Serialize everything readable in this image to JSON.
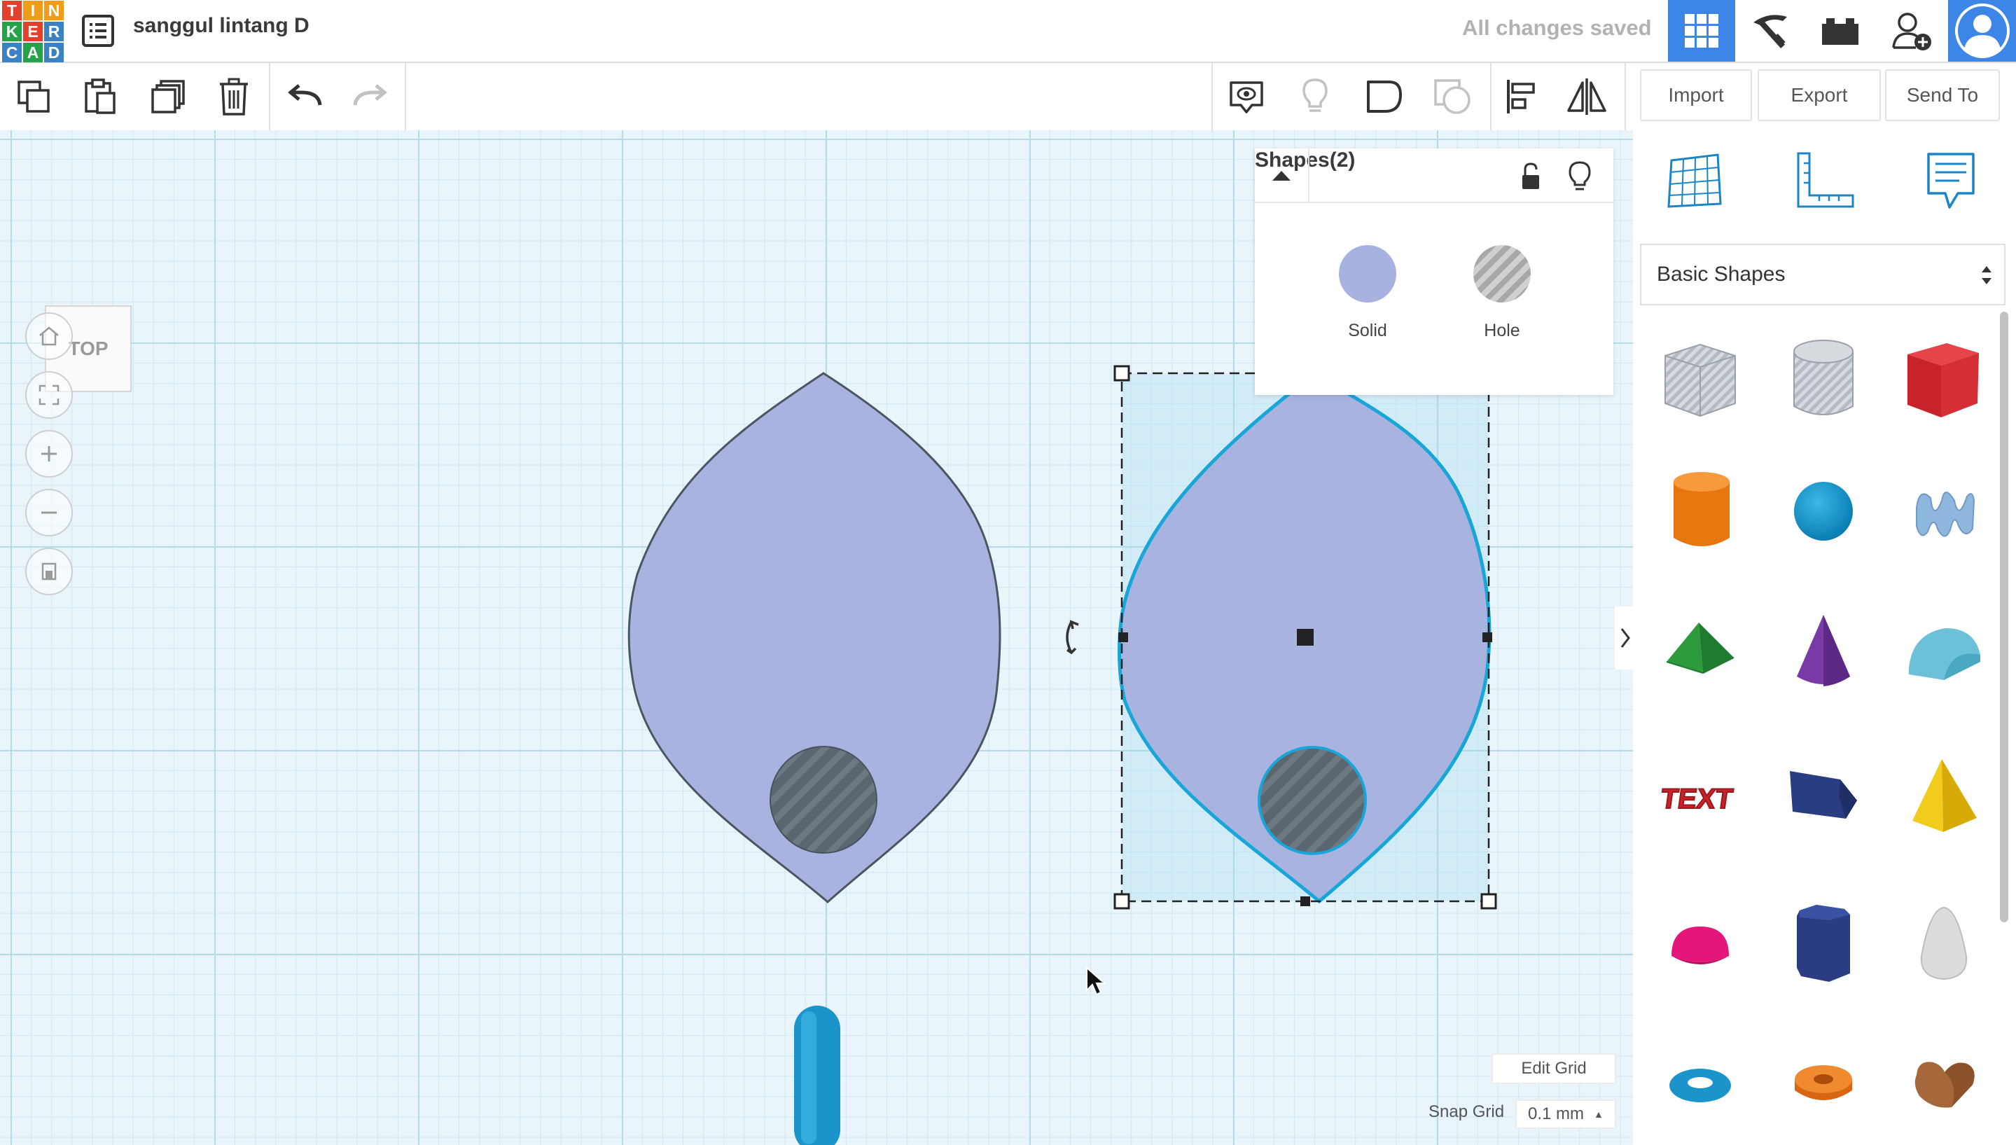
{
  "app": {
    "logo_letters": [
      "T",
      "I",
      "N",
      "K",
      "E",
      "R",
      "C",
      "A",
      "D"
    ],
    "logo_colors": [
      "#e4412c",
      "#f19b1a",
      "#f19b1a",
      "#24a348",
      "#e4412c",
      "#3b82c4",
      "#3b82c4",
      "#24a348",
      "#3b82c4"
    ],
    "design_name": "sanggul lintang D",
    "save_status": "All changes saved"
  },
  "colors": {
    "accent": "#3d85e6",
    "shape_fill": "#a7b2e0",
    "selection": "#1aa3d6",
    "hole": "#5a666f"
  },
  "topbar_icons": [
    "grid-view-icon",
    "pickaxe-icon",
    "bricks-icon",
    "add-user-icon",
    "profile-avatar-icon"
  ],
  "toolbar": {
    "left_tools": [
      "copy-icon",
      "paste-icon",
      "duplicate-icon",
      "delete-icon",
      "undo-icon",
      "redo-icon"
    ],
    "right_tools": [
      "notes-icon",
      "light-icon",
      "group-icon",
      "ungroup-icon",
      "align-icon",
      "mirror-icon"
    ],
    "import_label": "Import",
    "export_label": "Export",
    "send_to_label": "Send To"
  },
  "viewcube": {
    "label": "TOP"
  },
  "nav_controls": [
    "home-view-icon",
    "fit-view-icon",
    "zoom-in-icon",
    "zoom-out-icon",
    "perspective-icon"
  ],
  "inspector": {
    "title": "Shapes(2)",
    "solid_label": "Solid",
    "hole_label": "Hole",
    "solid_color": "#a7b2e0"
  },
  "right_panel": {
    "tabs": [
      "workplane-icon",
      "ruler-icon",
      "notes-tab-icon"
    ],
    "category": "Basic Shapes",
    "shapes": [
      "box-hole-shape",
      "cylinder-hole-shape",
      "box-shape",
      "cylinder-shape",
      "sphere-shape",
      "scribble-shape",
      "roof-shape",
      "cone-shape",
      "round-roof-shape",
      "text-shape",
      "wedge-shape",
      "pyramid-shape",
      "half-sphere-shape",
      "polygon-shape",
      "paraboloid-shape",
      "torus-shape",
      "tube-shape",
      "heart-shape"
    ],
    "text_shape_label": "TEXT"
  },
  "bottom": {
    "edit_grid": "Edit Grid",
    "snap_grid_label": "Snap Grid",
    "snap_grid_value": "0.1 mm"
  }
}
